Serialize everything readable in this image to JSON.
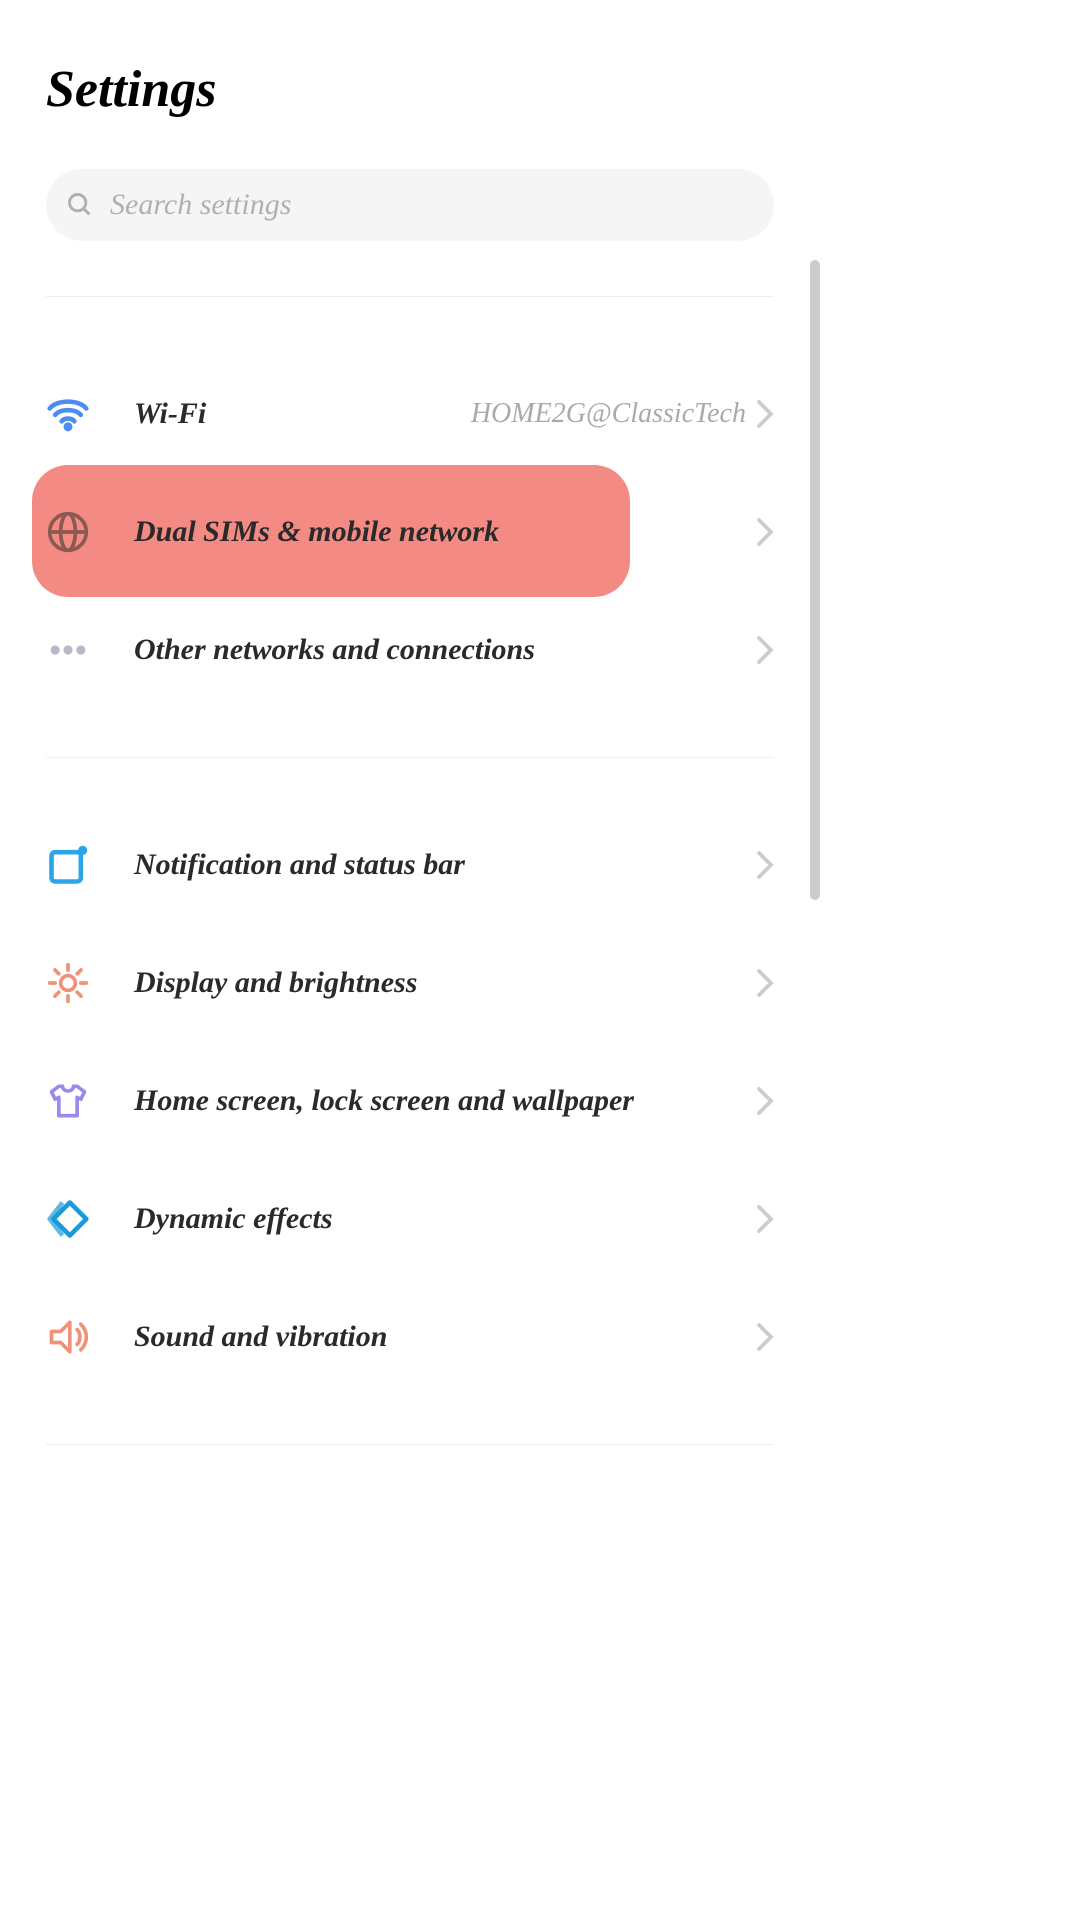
{
  "header": {
    "title": "Settings"
  },
  "search": {
    "placeholder": "Search settings"
  },
  "groups": [
    {
      "items": [
        {
          "label": "Wi-Fi",
          "value": "HOME2G@ClassicTech",
          "icon": "wifi"
        },
        {
          "label": "Dual SIMs & mobile network",
          "value": "",
          "icon": "globe",
          "highlighted": true
        },
        {
          "label": "Other networks and connections",
          "value": "",
          "icon": "dots"
        }
      ]
    },
    {
      "items": [
        {
          "label": "Notification and status bar",
          "value": "",
          "icon": "notification"
        },
        {
          "label": "Display and brightness",
          "value": "",
          "icon": "brightness"
        },
        {
          "label": "Home screen, lock screen and wallpaper",
          "value": "",
          "icon": "tshirt"
        },
        {
          "label": "Dynamic effects",
          "value": "",
          "icon": "diamond"
        },
        {
          "label": "Sound and vibration",
          "value": "",
          "icon": "sound"
        }
      ]
    }
  ]
}
